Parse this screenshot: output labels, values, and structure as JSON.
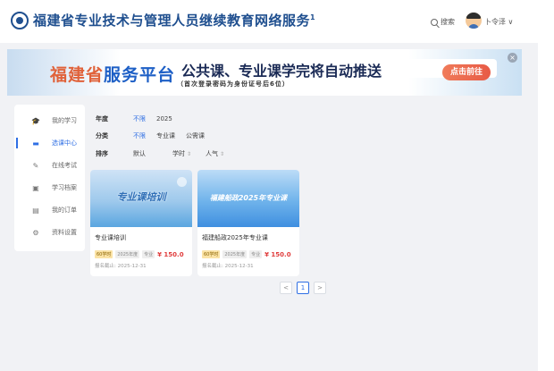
{
  "header": {
    "title": "福建省专业技术与管理人员继续教育网络服务",
    "title_suffix": "1",
    "search_label": "搜索",
    "username": "卜令泽",
    "username_caret": "∨"
  },
  "banner": {
    "brand_part1": "福建省",
    "brand_part2": "服务平台",
    "headline": "公共课、专业课学完将自动推送",
    "hint": "（首次登录密码为身份证号后6位）",
    "cta_label": "点击前往",
    "close_glyph": "×"
  },
  "sidebar": {
    "items": [
      {
        "icon": "graduation-cap-icon",
        "glyph": "🎓",
        "label": "我的学习"
      },
      {
        "icon": "monitor-icon",
        "glyph": "▬",
        "label": "选课中心"
      },
      {
        "icon": "edit-icon",
        "glyph": "✎",
        "label": "在线考试"
      },
      {
        "icon": "archive-icon",
        "glyph": "▣",
        "label": "学习档案"
      },
      {
        "icon": "order-icon",
        "glyph": "▤",
        "label": "我的订单"
      },
      {
        "icon": "gear-icon",
        "glyph": "⚙",
        "label": "资料设置"
      }
    ],
    "active_index": 1
  },
  "filters": {
    "year": {
      "label": "年度",
      "options": [
        "不限",
        "2025"
      ]
    },
    "category": {
      "label": "分类",
      "options": [
        "不限",
        "专业课",
        "公需课"
      ]
    },
    "sort": {
      "label": "排序",
      "options": [
        "默认",
        "学时",
        "人气"
      ]
    }
  },
  "courses": [
    {
      "thumb_text": "专业课培训",
      "title": "专业课培训",
      "hours_tag": "60学时",
      "year_tag": "2025年度",
      "type_tag": "专业",
      "price": "¥ 150.0",
      "deadline": "报名截止: 2025-12-31"
    },
    {
      "thumb_text": "福建船政2025年专业课",
      "title": "福建船政2025年专业课",
      "hours_tag": "60学时",
      "year_tag": "2025年度",
      "type_tag": "专业",
      "price": "¥ 150.0",
      "deadline": "报名截止: 2025-12-31"
    }
  ],
  "pagination": {
    "prev": "<",
    "current": "1",
    "next": ">"
  },
  "colors": {
    "accent": "#2f6fe4",
    "brand_blue": "#1f4f8f",
    "price_red": "#e03c3c",
    "cta_orange": "#e85a45"
  }
}
